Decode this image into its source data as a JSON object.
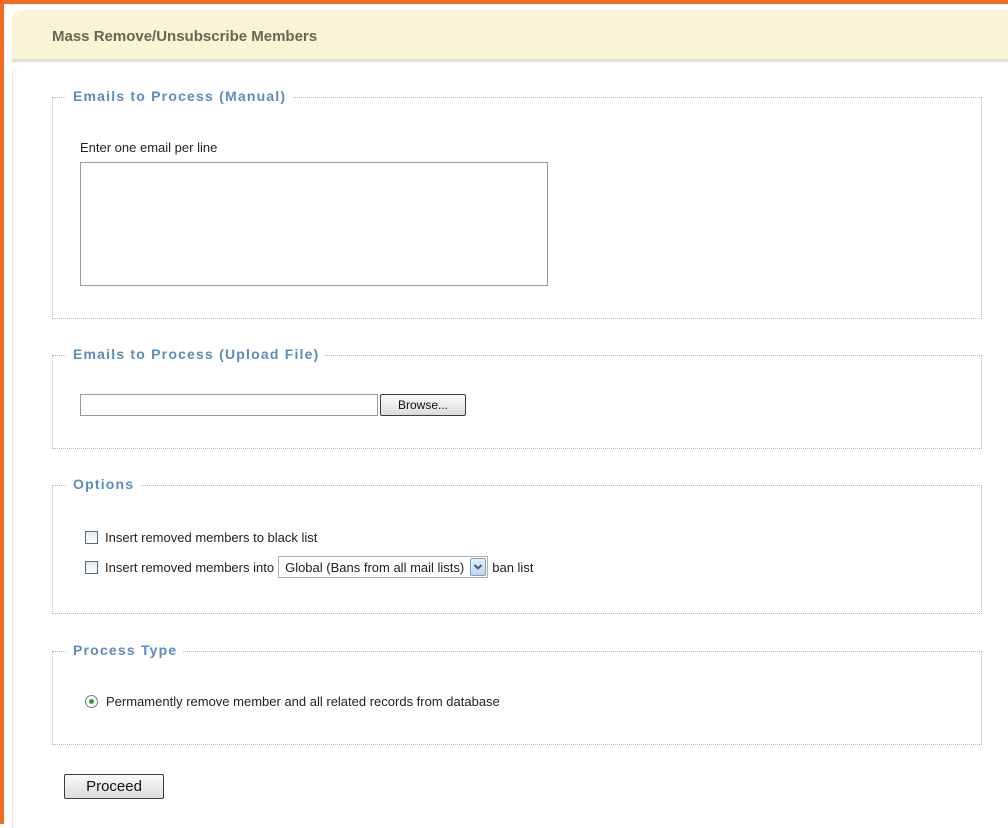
{
  "page": {
    "title": "Mass Remove/Unsubscribe Members"
  },
  "manual": {
    "legend": "Emails to Process (Manual)",
    "hint": "Enter one email per line",
    "textarea_value": ""
  },
  "upload": {
    "legend": "Emails to Process (Upload File)",
    "file_value": "",
    "browse_label": "Browse..."
  },
  "options": {
    "legend": "Options",
    "blacklist_label": "Insert removed members to black list",
    "blacklist_checked": false,
    "banlist_prefix": "Insert removed members into",
    "banlist_checked": false,
    "banlist_selected": "Global (Bans from all mail lists)",
    "banlist_suffix": "ban list",
    "select_arrow_icon": "chevron-down-icon"
  },
  "process_type": {
    "legend": "Process Type",
    "option_label": "Permamently remove member and all related records from database",
    "option_selected": true
  },
  "actions": {
    "proceed_label": "Proceed"
  },
  "colors": {
    "accent_border": "#f26d21",
    "header_bg": "#f8f5d6",
    "legend_text": "#5b8cc0",
    "radio_selected": "#2f9f3a"
  }
}
